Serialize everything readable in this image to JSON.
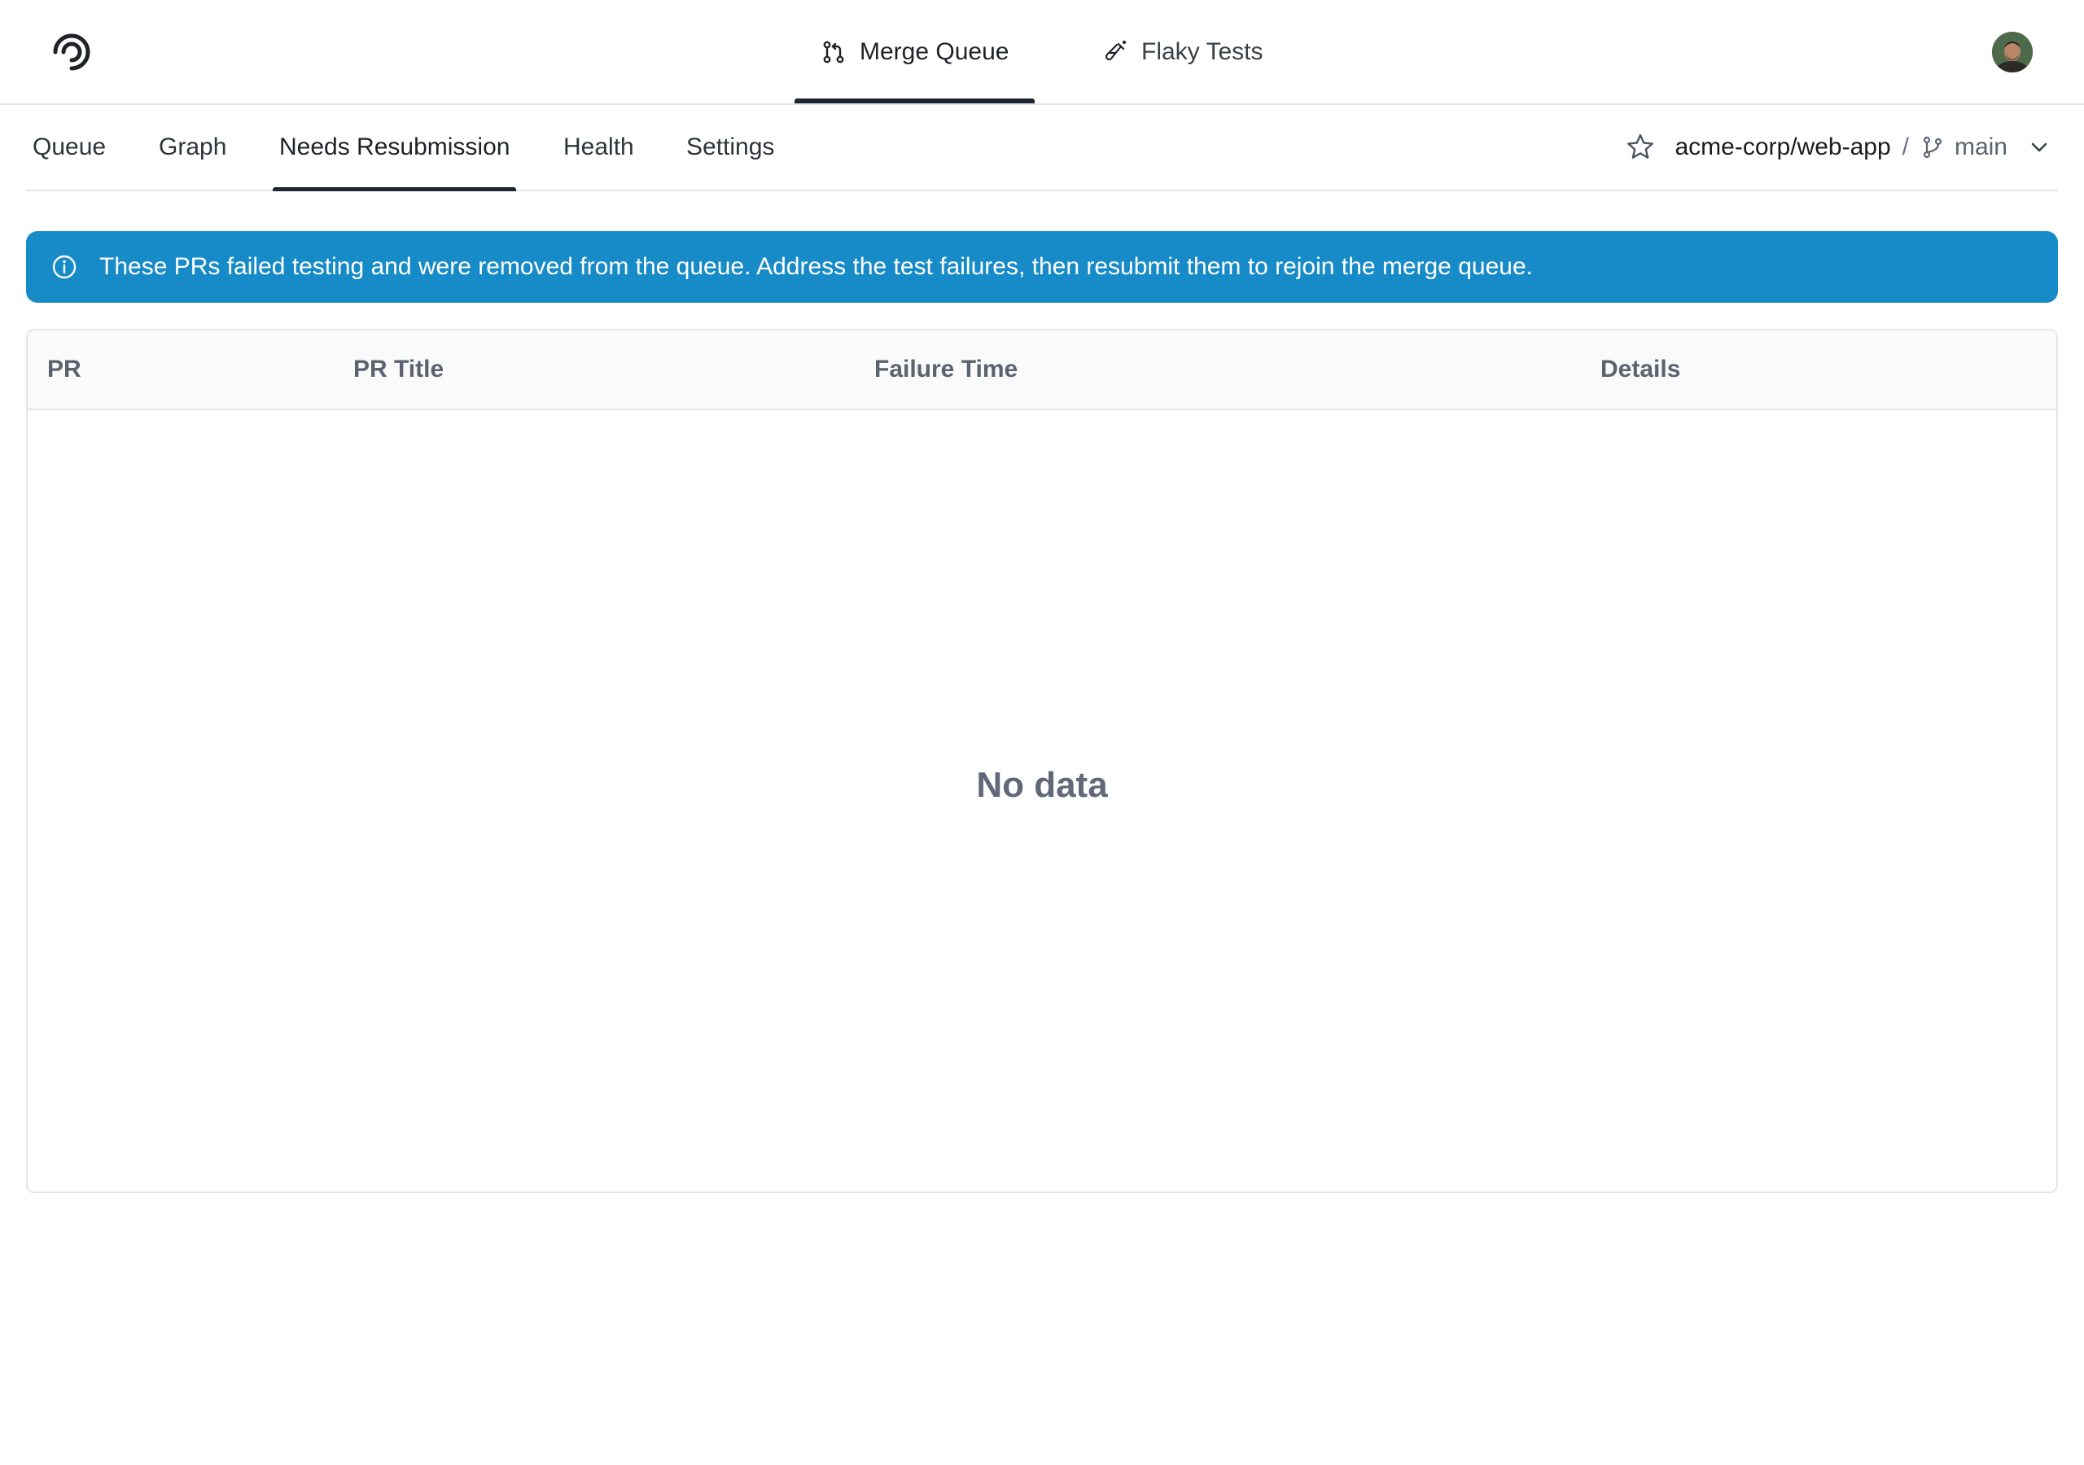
{
  "header": {
    "tabs": [
      {
        "label": "Merge Queue",
        "icon": "git-pull-request-icon",
        "active": true
      },
      {
        "label": "Flaky Tests",
        "icon": "test-tube-icon",
        "active": false
      }
    ],
    "logo_icon": "trunk-logo-icon",
    "avatar_icon": "user-avatar"
  },
  "subnav": {
    "tabs": [
      {
        "label": "Queue",
        "active": false
      },
      {
        "label": "Graph",
        "active": false
      },
      {
        "label": "Needs Resubmission",
        "active": true
      },
      {
        "label": "Health",
        "active": false
      },
      {
        "label": "Settings",
        "active": false
      }
    ],
    "repo": "acme-corp/web-app",
    "separator": "/",
    "branch": "main"
  },
  "banner": {
    "text": "These PRs failed testing and were removed from the queue. Address the test failures, then resubmit them to rejoin the merge queue.",
    "color": "#178ac8"
  },
  "table": {
    "columns": [
      "PR",
      "PR Title",
      "Failure Time",
      "Details"
    ],
    "rows": [],
    "empty_text": "No data"
  }
}
